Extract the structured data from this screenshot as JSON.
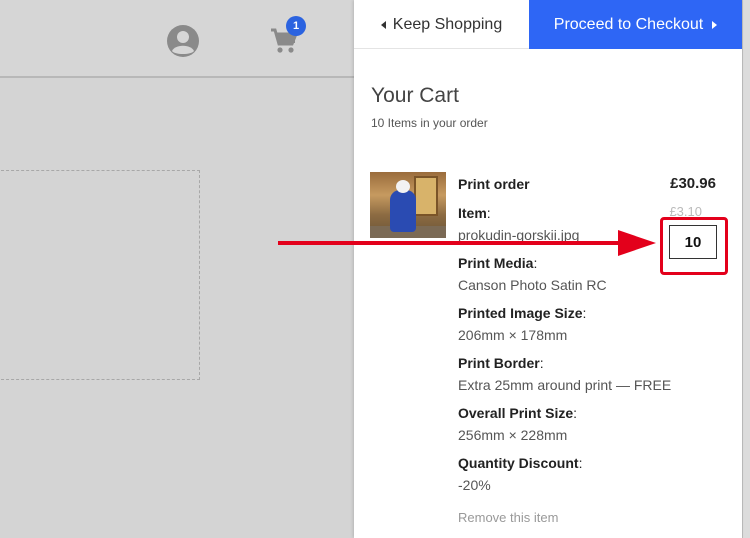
{
  "header": {
    "account_icon": "account-circle-icon",
    "cart_icon": "shopping-cart-icon",
    "cart_badge_count": "1"
  },
  "cart_panel": {
    "keep_shopping_label": "Keep Shopping",
    "checkout_label": "Proceed to Checkout",
    "title": "Your Cart",
    "subtitle": "10 Items in your order",
    "item": {
      "name": "Print order",
      "total_price": "£30.96",
      "item_label": "Item",
      "item_value": "prokudin-gorskii.jpg",
      "unit_price": "£3.10",
      "quantity": "10",
      "print_media_label": "Print Media",
      "print_media_value": "Canson Photo Satin RC",
      "printed_size_label": "Printed Image Size",
      "printed_size_value": "206mm × 178mm",
      "print_border_label": "Print Border",
      "print_border_value": "Extra 25mm around print — FREE",
      "overall_size_label": "Overall Print Size",
      "overall_size_value": "256mm × 228mm",
      "quantity_discount_label": "Quantity Discount",
      "quantity_discount_value": "-20%",
      "remove_label": "Remove this item"
    }
  },
  "colors": {
    "accent": "#2e66f5",
    "badge": "#2b63e0",
    "annotation": "#e3001b"
  }
}
